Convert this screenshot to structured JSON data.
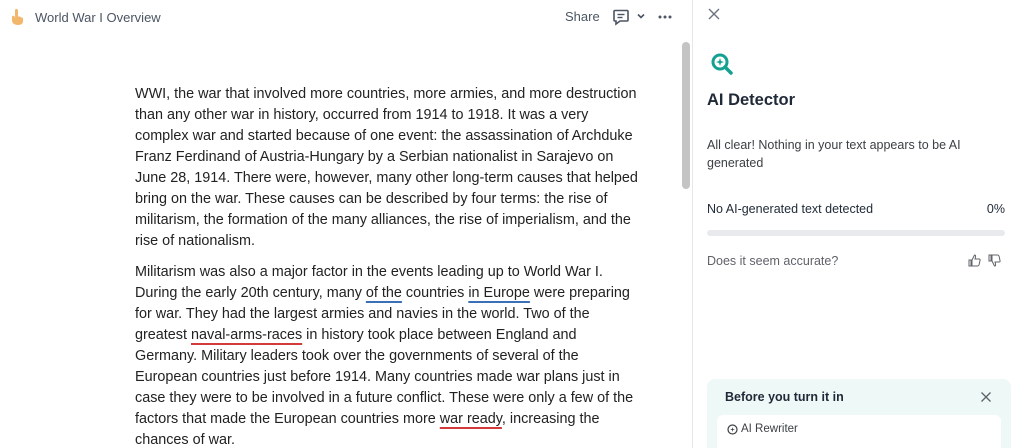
{
  "header": {
    "doc_title": "World War I Overview",
    "share_label": "Share",
    "icons": {
      "doc": "pointing-hand-icon",
      "comment": "comment-icon",
      "chevron": "chevron-down-icon",
      "more": "more-horizontal-icon"
    }
  },
  "document": {
    "p1": "WWI, the war that involved more countries, more armies, and more destruction than any other war in history, occurred from 1914 to 1918. It was a very complex war and started because of one event: the assassination of Archduke Franz Ferdinand of Austria-Hungary by a Serbian nationalist in Sarajevo on June 28, 1914. There were, however, many other long-term causes that helped bring on the war. These causes can be described by four terms: the rise of militarism, the formation of the many alliances, the rise of imperialism, and the rise of nationalism.",
    "p2": {
      "s1": "Militarism was also a major factor in the events leading up to World War I. During the early 20th century, many ",
      "u1": "of the",
      "s2": " countries ",
      "u2": "in Europe",
      "s3": " were preparing for war. They had the largest armies and navies in the world. Two of the greatest ",
      "u3": "naval-arms-races",
      "s4": " in history took place between England and Germany. Military leaders took over the governments of several of the European countries just before 1914. Many countries made war plans just in case they were to be involved in a future conflict. These were only a few of the factors that made the European countries more ",
      "u4": "war ready",
      "s5": ", increasing the chances of war."
    }
  },
  "panel": {
    "title": "AI Detector",
    "result_message": "All clear! Nothing in your text appears to be AI generated",
    "result_label": "No AI-generated text detected",
    "result_percent": "0%",
    "ai_fraction": 0,
    "feedback_question": "Does it seem accurate?",
    "turn_in": {
      "title": "Before you turn it in",
      "rewriter_label": "AI Rewriter"
    },
    "colors": {
      "accent": "#15a191",
      "card_bg": "#eef8f7"
    }
  },
  "scrollbar": {
    "position_fraction": 0
  }
}
